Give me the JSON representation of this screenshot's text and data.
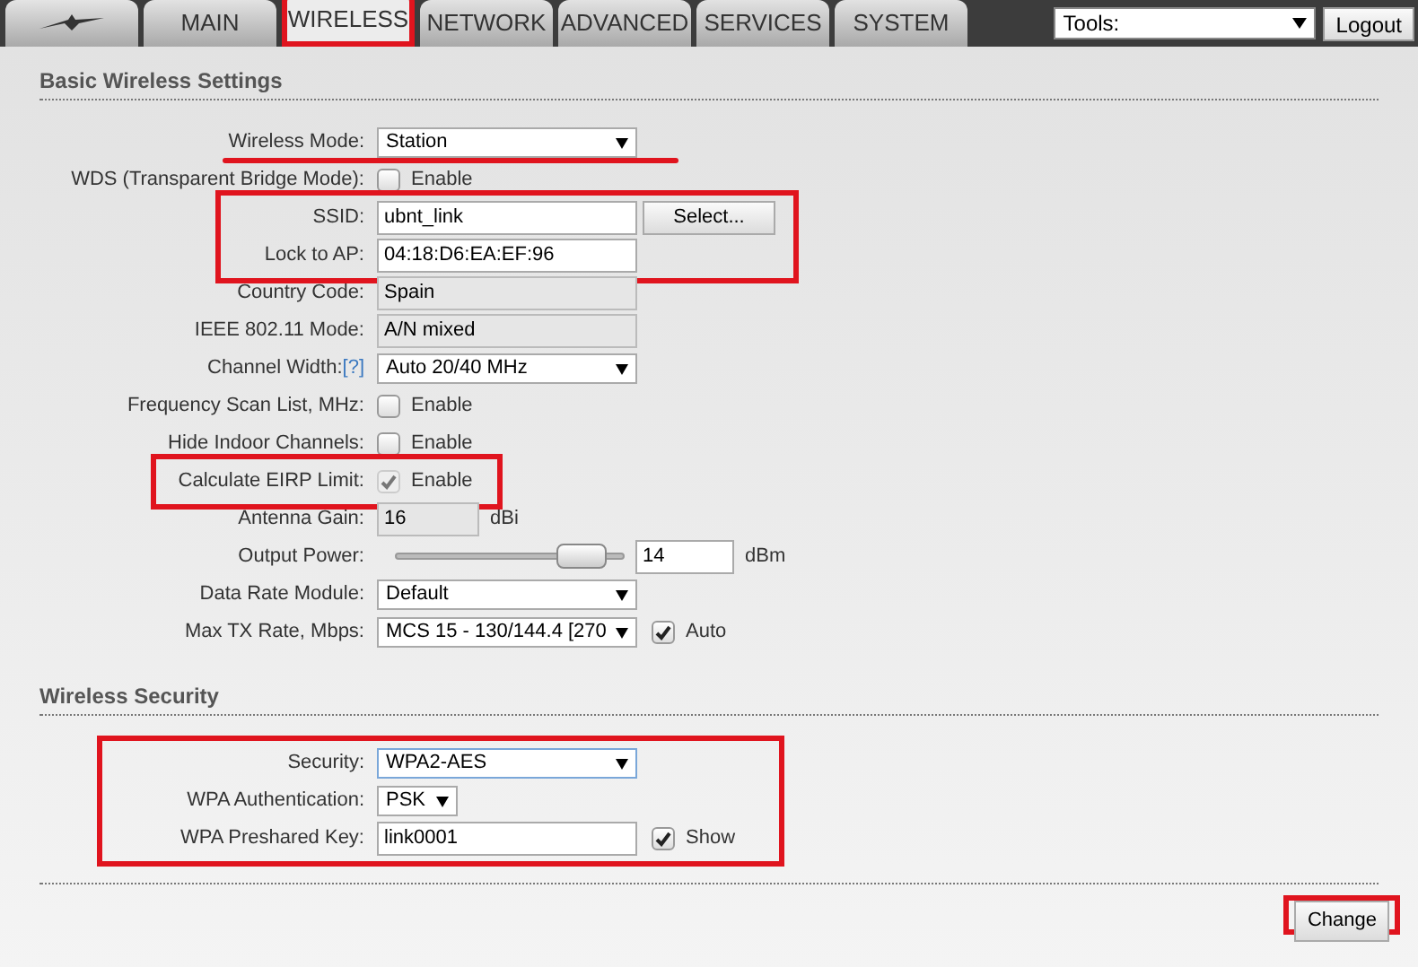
{
  "tabs": [
    {
      "label": "MAIN",
      "selected": false,
      "highlighted": false
    },
    {
      "label": "WIRELESS",
      "selected": true,
      "highlighted": true
    },
    {
      "label": "NETWORK",
      "selected": false,
      "highlighted": false
    },
    {
      "label": "ADVANCED",
      "selected": false,
      "highlighted": false
    },
    {
      "label": "SERVICES",
      "selected": false,
      "highlighted": false
    },
    {
      "label": "SYSTEM",
      "selected": false,
      "highlighted": false
    }
  ],
  "tools": {
    "value": "Tools:"
  },
  "logout": "Logout",
  "sections": [
    {
      "title": "Basic Wireless Settings",
      "groups": [
        {
          "framed": false,
          "underlined": true,
          "rows": [
            {
              "kind": "select",
              "label": "Wireless Mode:",
              "value": "Station"
            }
          ]
        },
        {
          "framed": false,
          "underlined": false,
          "rows": [
            {
              "kind": "checkbox",
              "label": "WDS (Transparent Bridge Mode):",
              "checked": false,
              "disabled": false,
              "text": "Enable"
            }
          ]
        },
        {
          "framed": true,
          "underlined": false,
          "rows": [
            {
              "kind": "text",
              "label": "SSID:",
              "value": "ubnt_link",
              "button": "Select..."
            },
            {
              "kind": "text",
              "label": "Lock to AP:",
              "value": "04:18:D6:EA:EF:96"
            }
          ]
        },
        {
          "framed": false,
          "underlined": false,
          "rows": [
            {
              "kind": "readonly",
              "label": "Country Code:",
              "value": "Spain"
            },
            {
              "kind": "readonly",
              "label": "IEEE 802.11 Mode:",
              "value": "A/N mixed"
            },
            {
              "kind": "select",
              "label": "Channel Width:",
              "help": "[?]",
              "value": "Auto 20/40 MHz"
            },
            {
              "kind": "checkbox",
              "label": "Frequency Scan List, MHz:",
              "checked": false,
              "disabled": false,
              "text": "Enable"
            },
            {
              "kind": "checkbox",
              "label": "Hide Indoor Channels:",
              "checked": false,
              "disabled": false,
              "text": "Enable"
            }
          ]
        },
        {
          "framed": true,
          "underlined": false,
          "rows": [
            {
              "kind": "checkbox",
              "label": "Calculate EIRP Limit:",
              "checked": true,
              "disabled": true,
              "text": "Enable"
            }
          ]
        },
        {
          "framed": false,
          "underlined": false,
          "rows": [
            {
              "kind": "readonly",
              "label": "Antenna Gain:",
              "value": "16",
              "short": true,
              "unit": "dBi"
            },
            {
              "kind": "slider",
              "label": "Output Power:",
              "level": 0.9,
              "value": "14",
              "unit": "dBm"
            },
            {
              "kind": "select",
              "label": "Data Rate Module:",
              "value": "Default"
            },
            {
              "kind": "select",
              "label": "Max TX Rate, Mbps:",
              "value": "MCS 15 - 130/144.4 [270",
              "option": {
                "checked": true,
                "text": "Auto"
              }
            }
          ]
        }
      ]
    },
    {
      "title": "Wireless Security",
      "groups": [
        {
          "framed": true,
          "underlined": false,
          "rows": [
            {
              "kind": "select",
              "label": "Security:",
              "value": "WPA2-AES",
              "focused": true
            },
            {
              "kind": "select",
              "label": "WPA Authentication:",
              "value": "PSK",
              "short": true
            },
            {
              "kind": "text",
              "label": "WPA Preshared Key:",
              "value": "link0001",
              "option": {
                "checked": true,
                "text": "Show"
              }
            }
          ]
        }
      ]
    }
  ],
  "change": {
    "label": "Change",
    "highlighted": true
  }
}
